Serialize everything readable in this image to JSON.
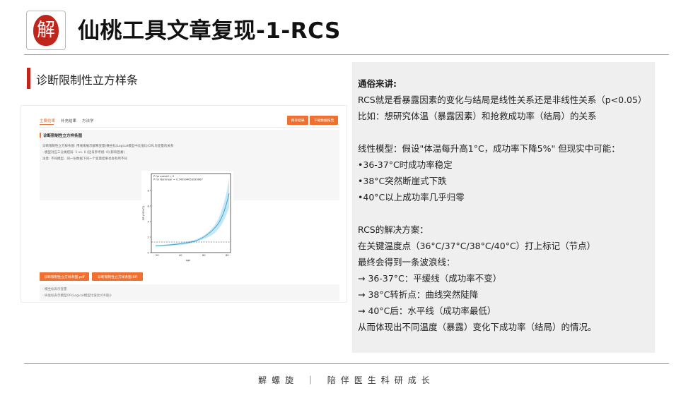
{
  "header": {
    "logo_char": "解",
    "title": "仙桃工具文章复现-1-RCS"
  },
  "section": {
    "title": "诊断限制性立方样条"
  },
  "app": {
    "tabs": [
      "主要结果",
      "补充结果",
      "方法学"
    ],
    "save_button": "保存结果",
    "report_button": "下载数据报告",
    "panel_title": "诊断限制性立方样条图",
    "panel_lines": [
      "诊断限制性立方样条图: 用线来展示解释变量(横坐标)Logical模型中比值比(OR)与变量的关系",
      "- 模型对应三分类结局: 1 vs. 0 (括号参考组: 0)(影响因素)",
      "注意: 不同模型、同一份数据下同一个变量结果也会有所不同"
    ],
    "plot": {
      "legend": [
        "P for overall = 0",
        "P for Nonlinear = 0.545994653935667"
      ],
      "y_label": "OR (95%CI)",
      "x_label": "age",
      "y_ticks": [
        "0",
        "2",
        "4",
        "6",
        "8"
      ],
      "x_ticks": [
        "20",
        "40",
        "60",
        "80"
      ]
    },
    "download_buttons": [
      "诊断限制性立方样条图.pdf",
      "诊断限制性立方样条图.tiff"
    ],
    "notes": [
      "- 横坐标表示变量",
      "- 纵坐标表示模型OR(Logical模型比值比(OR值))"
    ]
  },
  "explain": {
    "lines": [
      {
        "text": "通俗来讲:",
        "bold": true
      },
      {
        "text": "RCS就是看暴露因素的变化与结局是线性关系还是非线性关系（p<0.05）",
        "bold": false
      },
      {
        "text": "比如：想研究体温（暴露因素）和抢救成功率（结局）的关系",
        "bold": false
      },
      {
        "text": "",
        "bold": false
      },
      {
        "text": "线性模型：假设\"体温每升高1°C，成功率下降5%\" 但现实中可能：",
        "bold": false
      },
      {
        "text": "•36-37°C时成功率稳定",
        "bold": false
      },
      {
        "text": "•38°C突然断崖式下跌",
        "bold": false
      },
      {
        "text": "•40°C以上成功率几乎归零",
        "bold": false
      },
      {
        "text": "",
        "bold": false
      },
      {
        "text": "RCS的解决方案：",
        "bold": false
      },
      {
        "text": "在关键温度点（36°C/37°C/38°C/40°C）打上标记（节点）",
        "bold": false
      },
      {
        "text": "最终会得到一条波浪线：",
        "bold": false
      },
      {
        "text": "→ 36-37°C：平缓线（成功率不变）",
        "bold": false
      },
      {
        "text": "→ 38°C转折点：曲线突然陡降",
        "bold": false
      },
      {
        "text": "→ 40°C后：水平线（成功率最低）",
        "bold": false
      },
      {
        "text": "从而体现出不同温度（暴露）变化下成功率（结局）的情况。",
        "bold": false
      }
    ]
  },
  "footer": {
    "text": "解螺旋 ｜ 陪伴医生科研成长"
  },
  "colors": {
    "accent_red": "#c0251b",
    "button_orange": "#f07030",
    "curve_blue": "#3aa6d6",
    "band": "#bfe4f3"
  }
}
